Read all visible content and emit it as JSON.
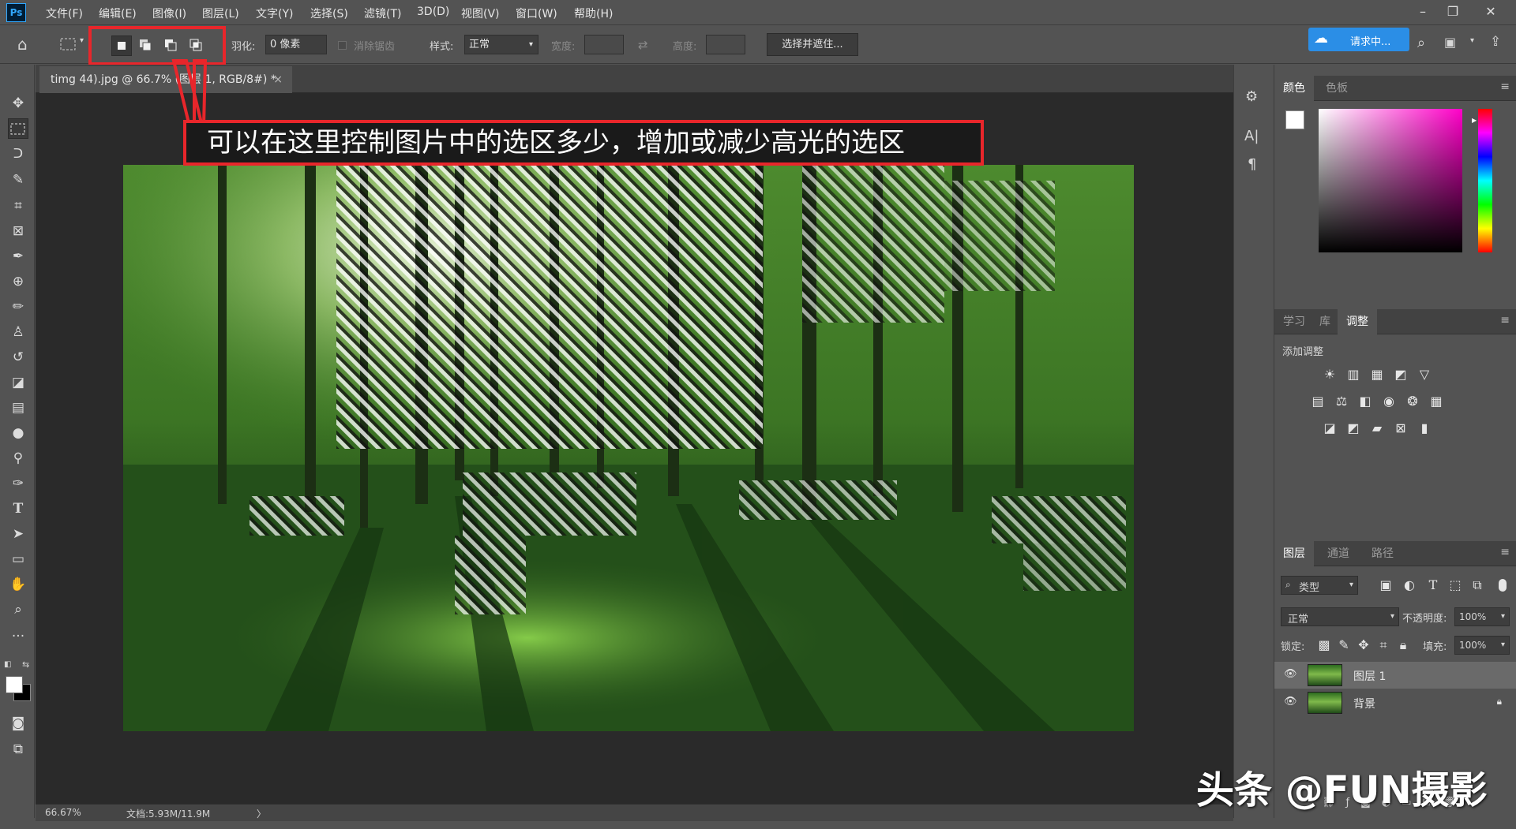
{
  "menubar": {
    "logo": "Ps",
    "items": [
      "文件(F)",
      "编辑(E)",
      "图像(I)",
      "图层(L)",
      "文字(Y)",
      "选择(S)",
      "滤镜(T)",
      "3D(D)",
      "视图(V)",
      "窗口(W)",
      "帮助(H)"
    ],
    "window_controls": [
      "minimize-icon",
      "restore-icon",
      "close-icon"
    ]
  },
  "options": {
    "feather_label": "羽化:",
    "feather_value": "0 像素",
    "antialias_label": "消除锯齿",
    "style_label": "样式:",
    "style_value": "正常",
    "width_label": "宽度:",
    "height_label": "高度:",
    "select_mask_button": "选择并遮住...",
    "help_badge": "请求中..."
  },
  "document": {
    "tab_title": "timg 44).jpg @ 66.7% (图层 1, RGB/8#) *",
    "tab_close": "×",
    "zoom": "66.67%",
    "doc_size": "文档:5.93M/11.9M",
    "status_arrow": "〉"
  },
  "annotation": {
    "callout_text": "可以在这里控制图片中的选区多少，增加或减少高光的选区",
    "highlight_color": "#e8262b"
  },
  "iconstrip": {
    "text_tool": "A|",
    "paragraph": "¶"
  },
  "color_panel": {
    "tabs": [
      "颜色",
      "色板"
    ],
    "active_tab": "颜色"
  },
  "adjust_panel": {
    "tabs": [
      "学习",
      "库",
      "调整"
    ],
    "active_tab": "调整",
    "title": "添加调整"
  },
  "layers_panel": {
    "tabs": [
      "图层",
      "通道",
      "路径"
    ],
    "active_tab": "图层",
    "filter_value": "类型",
    "blend_mode": "正常",
    "opacity_label": "不透明度:",
    "opacity_value": "100%",
    "lock_label": "锁定:",
    "fill_label": "填充:",
    "fill_value": "100%",
    "layers": [
      {
        "name": "图层 1",
        "selected": true
      },
      {
        "name": "背景",
        "selected": false,
        "locked": true
      }
    ]
  },
  "watermark": "头条 @FUN摄影"
}
